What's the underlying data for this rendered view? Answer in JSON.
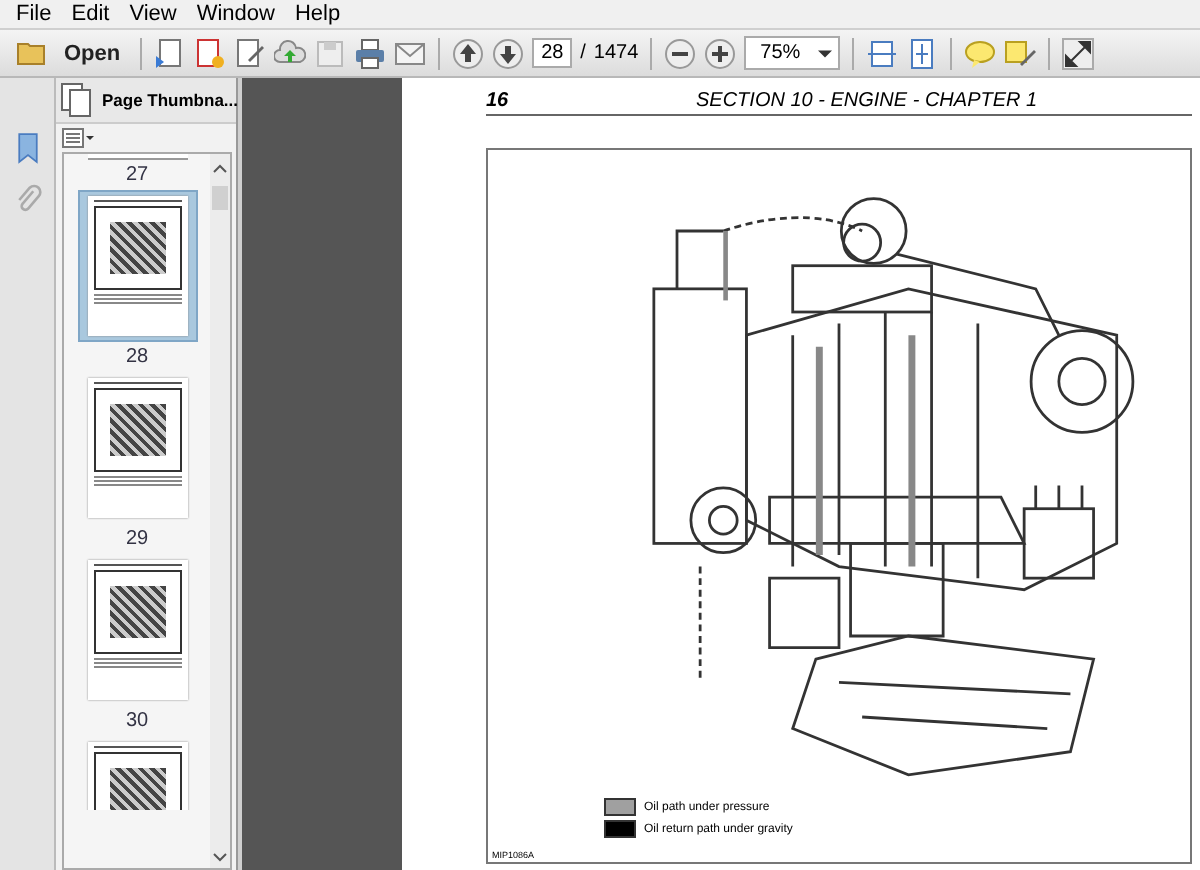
{
  "menu": [
    "File",
    "Edit",
    "View",
    "Window",
    "Help"
  ],
  "toolbar": {
    "open_label": "Open",
    "page_number": "28",
    "page_separator": "/",
    "page_count": "1474",
    "zoom": "75%"
  },
  "thumbnail_panel": {
    "title": "Page Thumbna...",
    "thumbnails": [
      {
        "label": "27",
        "kind": "cut-top"
      },
      {
        "label": "28",
        "selected": true,
        "kind": "full"
      },
      {
        "label": "29",
        "selected": false,
        "kind": "full"
      },
      {
        "label": "30",
        "selected": false,
        "kind": "full"
      },
      {
        "kind": "cut-bottom"
      }
    ]
  },
  "page": {
    "page_number": "16",
    "heading": "SECTION 10 - ENGINE - CHAPTER 1",
    "legend": [
      {
        "label": "Oil path under pressure",
        "color": "#a0a0a0"
      },
      {
        "label": "Oil return path under gravity",
        "color": "#000000"
      }
    ],
    "figure_code": "MIP1086A"
  }
}
